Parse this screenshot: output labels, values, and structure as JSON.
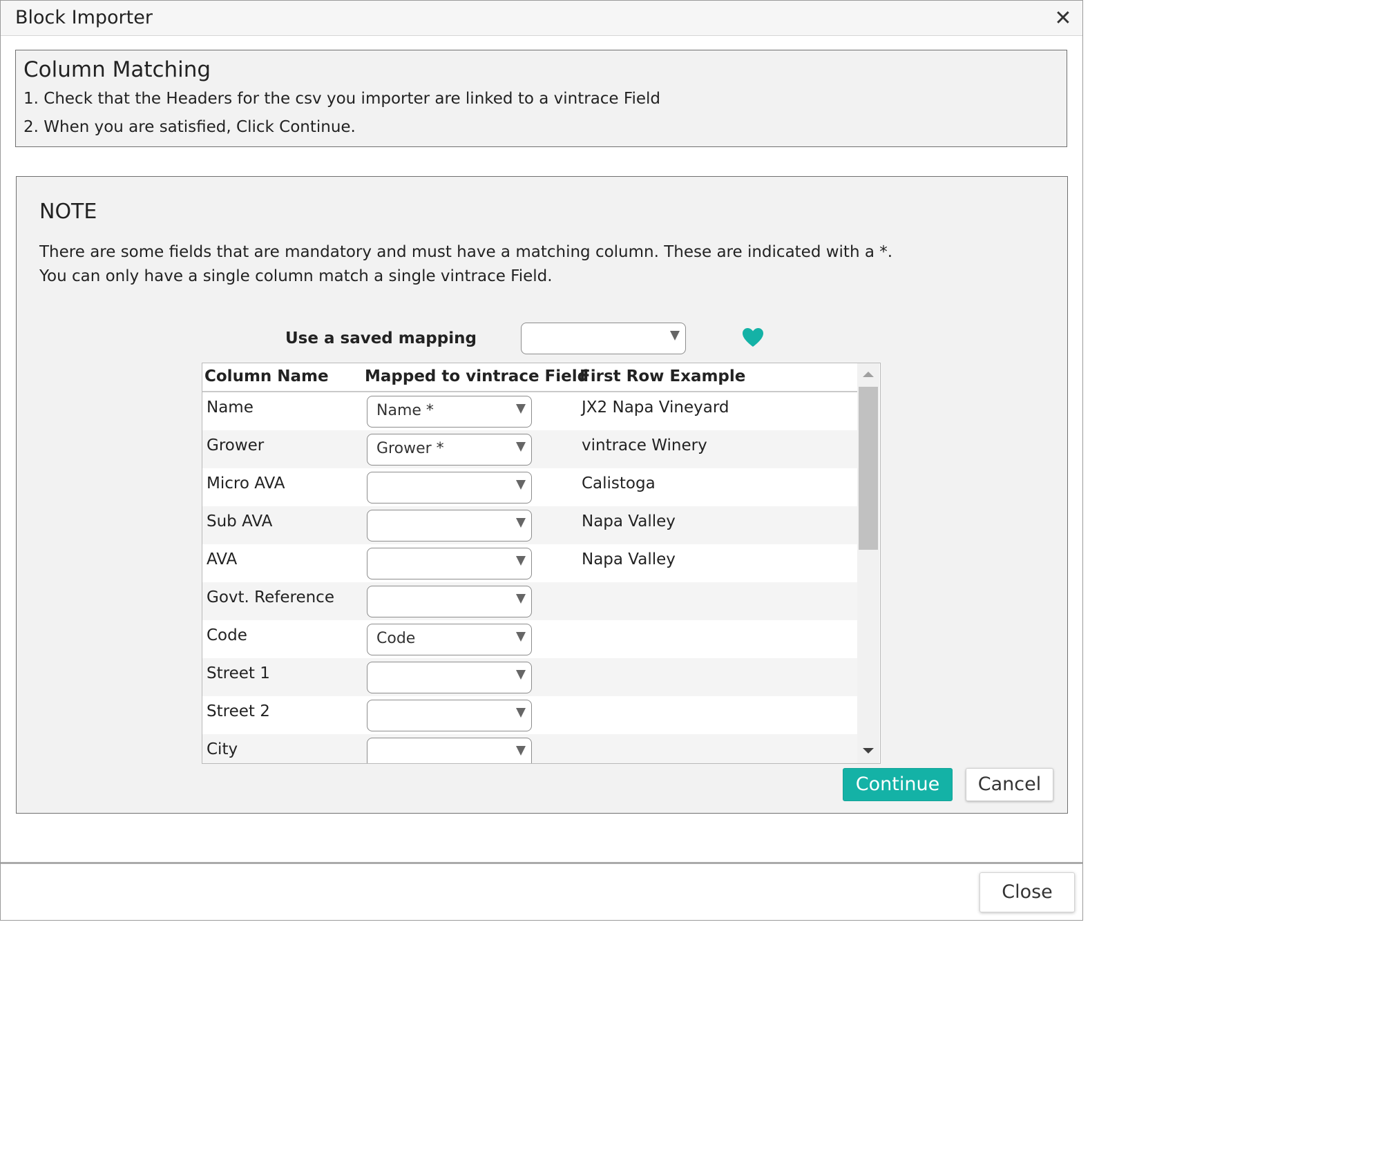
{
  "window": {
    "title": "Block Importer",
    "close_glyph": "✕"
  },
  "instructions": {
    "heading": "Column Matching",
    "step1": "1. Check that the Headers for the csv you importer are linked to a vintrace Field",
    "step2": "2. When you are satisfied, Click Continue."
  },
  "note": {
    "title": "NOTE",
    "line1": "There are some fields that are mandatory and must have a matching column. These are indicated with a *.",
    "line2": "You can only have a single column match a single vintrace Field."
  },
  "saved_mapping": {
    "label": "Use a saved mapping",
    "value": "",
    "favorite_icon": "heart-icon",
    "favorite_color": "#14b2a6"
  },
  "table": {
    "headers": {
      "column_name": "Column Name",
      "mapped": "Mapped to vintrace Field",
      "example": "First Row Example"
    },
    "rows": [
      {
        "column_name": "Name",
        "mapped": "Name *",
        "example": "JX2 Napa Vineyard"
      },
      {
        "column_name": "Grower",
        "mapped": "Grower *",
        "example": "vintrace Winery"
      },
      {
        "column_name": "Micro AVA",
        "mapped": "",
        "example": "Calistoga"
      },
      {
        "column_name": "Sub AVA",
        "mapped": "",
        "example": "Napa Valley"
      },
      {
        "column_name": "AVA",
        "mapped": "",
        "example": "Napa Valley"
      },
      {
        "column_name": "Govt. Reference",
        "mapped": "",
        "example": ""
      },
      {
        "column_name": "Code",
        "mapped": "Code",
        "example": ""
      },
      {
        "column_name": "Street 1",
        "mapped": "",
        "example": ""
      },
      {
        "column_name": "Street 2",
        "mapped": "",
        "example": ""
      },
      {
        "column_name": "City",
        "mapped": "",
        "example": ""
      }
    ]
  },
  "buttons": {
    "continue": "Continue",
    "cancel": "Cancel",
    "close": "Close"
  },
  "colors": {
    "accent": "#14b2a6"
  }
}
